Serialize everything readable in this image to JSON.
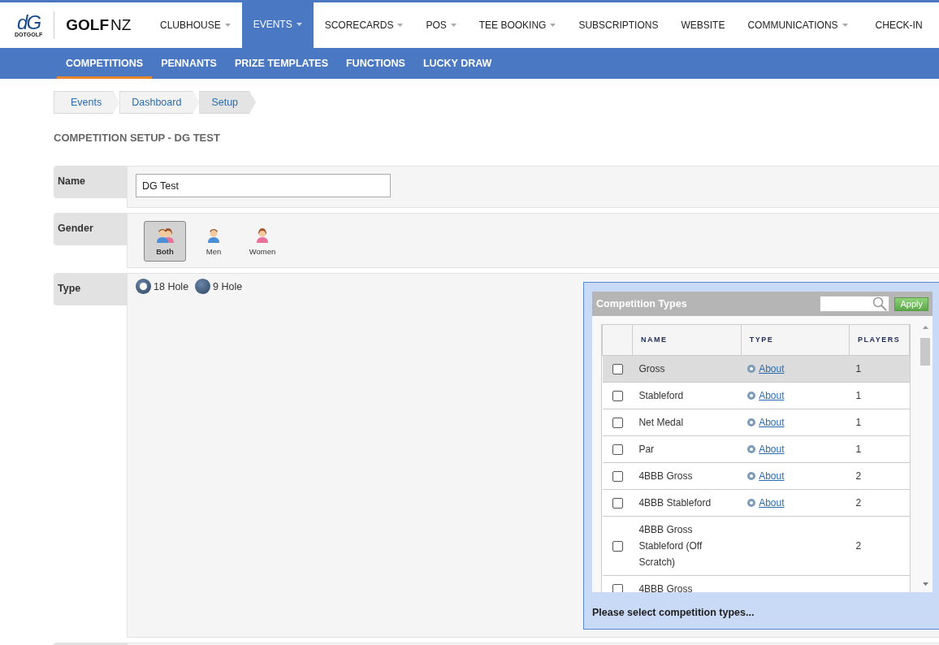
{
  "logo": {
    "mark": "dG",
    "name": "DOTGOLF",
    "brand": "GOLF",
    "brand_suffix": "NZ"
  },
  "nav": [
    {
      "label": "CLUBHOUSE",
      "dropdown": true,
      "selected": false
    },
    {
      "label": "EVENTS",
      "dropdown": true,
      "selected": true
    },
    {
      "label": "SCORECARDS",
      "dropdown": true,
      "selected": false
    },
    {
      "label": "POS",
      "dropdown": true,
      "selected": false
    },
    {
      "label": "TEE BOOKING",
      "dropdown": true,
      "selected": false
    },
    {
      "label": "SUBSCRIPTIONS",
      "dropdown": false,
      "selected": false
    },
    {
      "label": "WEBSITE",
      "dropdown": false,
      "selected": false
    },
    {
      "label": "COMMUNICATIONS",
      "dropdown": true,
      "selected": false
    },
    {
      "label": "CHECK-IN",
      "dropdown": false,
      "selected": false
    }
  ],
  "subnav": [
    {
      "label": "COMPETITIONS",
      "selected": true
    },
    {
      "label": "PENNANTS",
      "selected": false
    },
    {
      "label": "PRIZE TEMPLATES",
      "selected": false
    },
    {
      "label": "FUNCTIONS",
      "selected": false
    },
    {
      "label": "LUCKY DRAW",
      "selected": false
    }
  ],
  "breadcrumb": [
    "Events",
    "Dashboard",
    "Setup"
  ],
  "title": "COMPETITION SETUP - DG TEST",
  "name_field": {
    "label": "Name",
    "value": "DG Test"
  },
  "gender": {
    "label": "Gender",
    "options": [
      {
        "label": "Both",
        "kind": "both",
        "selected": true
      },
      {
        "label": "Men",
        "kind": "men",
        "selected": false
      },
      {
        "label": "Women",
        "kind": "women",
        "selected": false
      }
    ]
  },
  "type": {
    "label": "Type",
    "options": [
      {
        "label": "18 Hole",
        "selected": true
      },
      {
        "label": "9 Hole",
        "selected": false
      }
    ]
  },
  "competition_types": {
    "title": "Competition Types",
    "apply": "Apply",
    "columns": [
      "NAME",
      "TYPE",
      "PLAYERS"
    ],
    "rows": [
      {
        "name": "Gross",
        "link": "About",
        "players": "1",
        "checked": false,
        "highlighted": true
      },
      {
        "name": "Stableford",
        "link": "About",
        "players": "1",
        "checked": false,
        "highlighted": false
      },
      {
        "name": "Net Medal",
        "link": "About",
        "players": "1",
        "checked": false,
        "highlighted": false
      },
      {
        "name": "Par",
        "link": "About",
        "players": "1",
        "checked": false,
        "highlighted": false
      },
      {
        "name": "4BBB Gross",
        "link": "About",
        "players": "2",
        "checked": false,
        "highlighted": false
      },
      {
        "name": "4BBB Stableford",
        "link": "About",
        "players": "2",
        "checked": false,
        "highlighted": false
      },
      {
        "name": "4BBB Gross Stableford (Off Scratch)",
        "players": "2",
        "checked": false,
        "highlighted": false
      },
      {
        "name": "4BBB Gross",
        "checked": false,
        "highlighted": false
      }
    ],
    "message": "Please select competition types..."
  }
}
